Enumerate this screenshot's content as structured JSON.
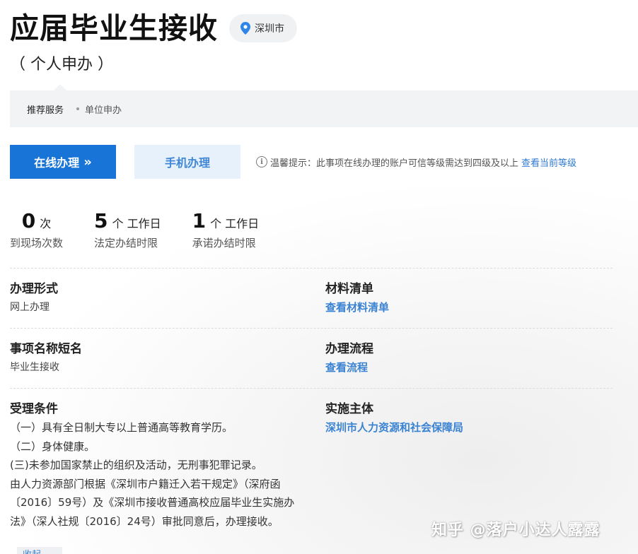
{
  "header": {
    "title": "应届毕业生接收",
    "location": "深圳市",
    "subtitle": "（ 个人申办 ）"
  },
  "tabs": [
    {
      "label": "推荐服务"
    },
    {
      "label": "单位申办"
    }
  ],
  "actions": {
    "online_label": "在线办理",
    "online_chevron": "»",
    "mobile_label": "手机办理",
    "tip_icon": "i",
    "tip_text": "温馨提示：此事项在线办理的账户可信等级需达到四级及以上",
    "tip_link": "查看当前等级"
  },
  "stats": [
    {
      "value": "0",
      "unit": "次",
      "label": "到现场次数"
    },
    {
      "value": "5",
      "unit": "个 工作日",
      "label": "法定办结时限"
    },
    {
      "value": "1",
      "unit": "个 工作日",
      "label": "承诺办结时限"
    }
  ],
  "details": {
    "form_label": "办理形式",
    "form_value": "网上办理",
    "materials_label": "材料清单",
    "materials_link": "查看材料清单",
    "shortname_label": "事项名称短名",
    "shortname_value": "毕业生接收",
    "process_label": "办理流程",
    "process_link": "查看流程",
    "conditions_label": "受理条件",
    "conditions": [
      "（一）具有全日制大专以上普通高等教育学历。",
      "（二）身体健康。",
      "(三)未参加国家禁止的组织及活动，无刑事犯罪记录。",
      "由人力资源部门根据《深圳市户籍迁入若干规定》（深府函〔2016〕59号）及《深圳市接收普通高校应届毕业生实施办法》（深人社规〔2016〕24号）审批同意后，办理接收。"
    ],
    "more_label": "收起",
    "agency_label": "实施主体",
    "agency_link": "深圳市人力资源和社会保障局"
  },
  "watermark": "知乎 @落户小达人露露",
  "colors": {
    "primary": "#1874d6",
    "link": "#3a82d2",
    "location_pin": "#2f86e8"
  }
}
